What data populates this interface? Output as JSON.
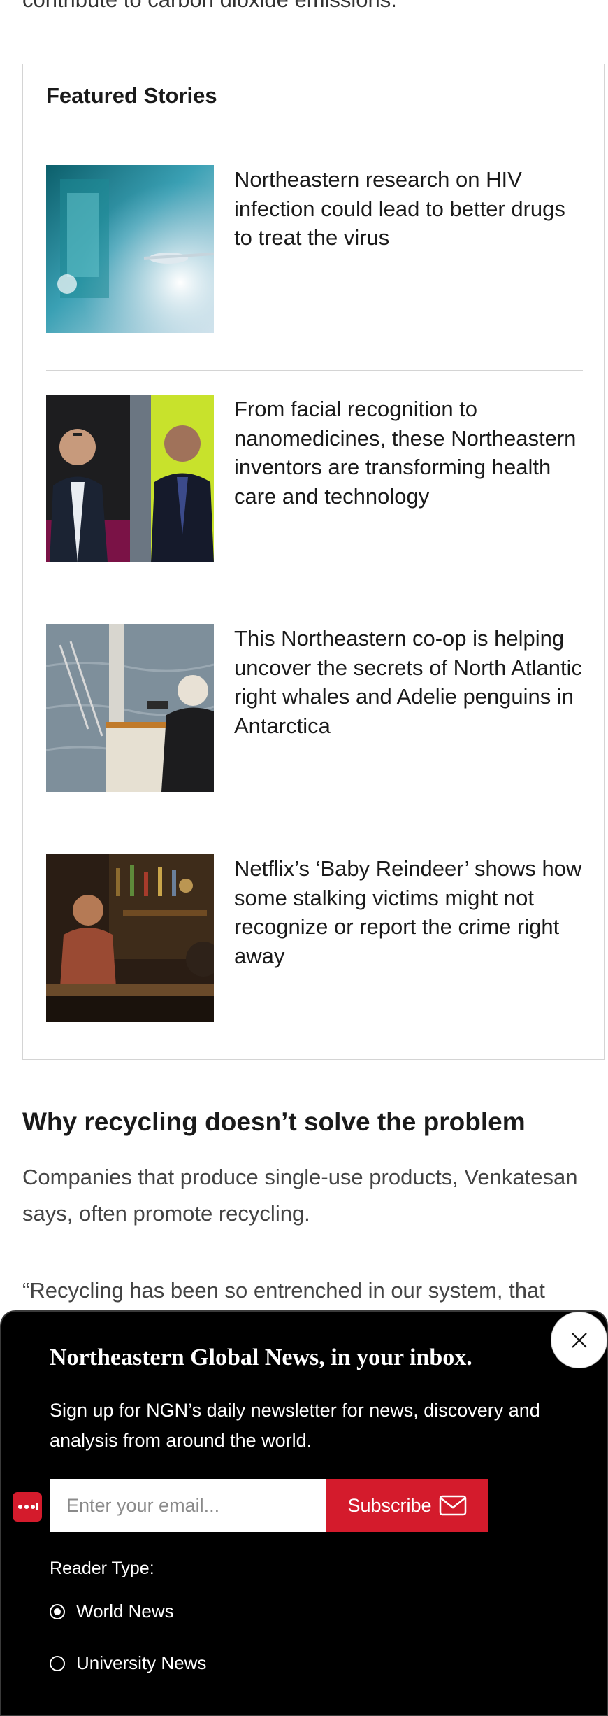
{
  "article": {
    "intro_fragment": "contribute to carbon dioxide emissions.",
    "section_heading": "Why recycling doesn’t solve the problem",
    "paragraph_1": "Companies that produce single-use products, Venkatesan says, often promote recycling.",
    "paragraph_2": "“Recycling has been so entrenched in our system, that"
  },
  "featured": {
    "title": "Featured Stories",
    "stories": [
      {
        "title": "Northeastern research on HIV infection could lead to better drugs to treat the virus"
      },
      {
        "title": "From facial recognition to nanomedicines, these Northeastern inventors are transforming health care and technology"
      },
      {
        "title": "This Northeastern co-op is helping uncover the secrets of North Atlantic right whales and Adelie penguins in Antarctica"
      },
      {
        "title": "Netflix’s ‘Baby Reindeer’ shows how some stalking victims might not recognize or report the crime right away"
      }
    ]
  },
  "newsletter": {
    "heading": "Northeastern Global News, in your inbox.",
    "description": "Sign up for NGN’s daily newsletter for news, discovery and analysis from around the world.",
    "email_placeholder": "Enter your email...",
    "subscribe_label": "Subscribe",
    "reader_type_label": "Reader Type:",
    "options": [
      {
        "label": "World News",
        "selected": true
      },
      {
        "label": "University News",
        "selected": false
      }
    ],
    "accent_color": "#d41b2c",
    "icons": {
      "close": "close-icon",
      "subscribe": "envelope-icon",
      "side_tab": "more-dots-icon"
    }
  }
}
